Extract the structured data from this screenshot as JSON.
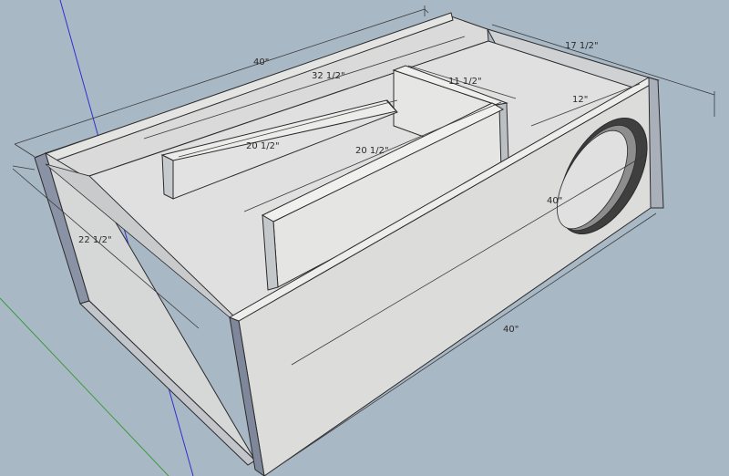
{
  "colors": {
    "background": "#a9b8c5",
    "panel_light": "#e8e8e6",
    "panel_mid": "#d2d3d3",
    "panel_dark": "#bfc3c7",
    "edge": "#2b2b2b",
    "panel_edge_shade": "#7f879a",
    "blue_axis": "#2f2fd0",
    "green_axis": "#3c9a3c",
    "port_dark": "#4a4a4a"
  },
  "dimensions": {
    "top_length": "40\"",
    "inner_length": "32 1/2\"",
    "right_depth": "17 1/2\"",
    "divider_depth": "11 1/2\"",
    "port_width": "12\"",
    "left_panel_length": "20 1/2\"",
    "center_panel_length": "20 1/2\"",
    "front_inner_length": "40\"",
    "front_bottom_length": "40\"",
    "left_depth": "22 1/2\""
  }
}
